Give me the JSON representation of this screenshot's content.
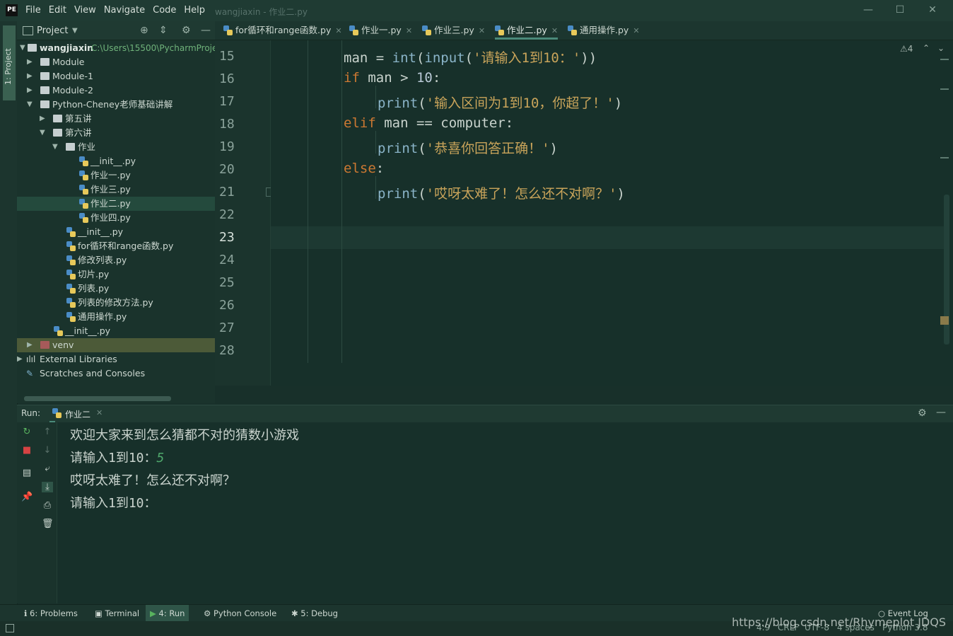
{
  "window": {
    "title": "wangjiaxin - 作业二.py",
    "logo": "PE",
    "menu": [
      "File",
      "Edit",
      "View",
      "Navigate",
      "Code",
      "Help"
    ]
  },
  "left_stripe": {
    "project_tab": "1: Project"
  },
  "project_panel": {
    "title": "Project",
    "root": {
      "name": "wangjiaxin",
      "path": "C:\\Users\\15500\\PycharmProjec"
    },
    "items": [
      "Module",
      "Module-1",
      "Module-2",
      "Python-Cheney老师基础讲解",
      "第五讲",
      "第六讲",
      "作业",
      "__init__.py",
      "作业一.py",
      "作业三.py",
      "作业二.py",
      "作业四.py",
      "__init__.py",
      "for循环和range函数.py",
      "修改列表.py",
      "切片.py",
      "列表.py",
      "列表的修改方法.py",
      "通用操作.py",
      "__init__.py",
      "venv",
      "External Libraries",
      "Scratches and Consoles"
    ]
  },
  "tabs": [
    "for循环和range函数.py",
    "作业一.py",
    "作业三.py",
    "作业二.py",
    "通用操作.py"
  ],
  "editor": {
    "warning_count": "4",
    "line_numbers": [
      "15",
      "16",
      "17",
      "18",
      "19",
      "20",
      "21",
      "22",
      "23",
      "24",
      "25",
      "26",
      "27",
      "28"
    ],
    "code": {
      "l15_a": "man = ",
      "l15_fn1": "int",
      "l15_b": "(",
      "l15_fn2": "input",
      "l15_c": "(",
      "l15_str": "'请输入1到10：'",
      "l15_d": "))",
      "l16_kw": "if",
      "l16_a": " man > ",
      "l16_num": "10",
      "l16_b": ":",
      "l17_fn": "print",
      "l17_a": "(",
      "l17_str": "'输入区间为1到10，你超了！'",
      "l17_b": ")",
      "l18_kw": "elif",
      "l18_a": " man == computer:",
      "l19_fn": "print",
      "l19_a": "(",
      "l19_str": "'恭喜你回答正确！'",
      "l19_b": ")",
      "l20_kw": "else",
      "l20_a": ":",
      "l21_fn": "print",
      "l21_a": "(",
      "l21_str": "'哎呀太难了！怎么还不对啊？'",
      "l21_b": ")"
    }
  },
  "run": {
    "label": "Run:",
    "tab": "作业二",
    "output": [
      "欢迎大家来到怎么猜都不对的猜数小游戏",
      "请输入1到10：",
      "哎呀太难了！怎么还不对啊？",
      "请输入1到10："
    ],
    "input_value": "5"
  },
  "bottom_tabs": [
    "6: Problems",
    "Terminal",
    "4: Run",
    "Python Console",
    "5: Debug"
  ],
  "event_log": "Event Log",
  "status": {
    "position": "4:9",
    "line_sep": "CRLF",
    "encoding": "UTF-8",
    "indent": "4 spaces",
    "interpreter": "Python 3.8"
  },
  "watermark": "https://blog.csdn.net/Rhymeplot",
  "watermark_tail": "JDQS"
}
